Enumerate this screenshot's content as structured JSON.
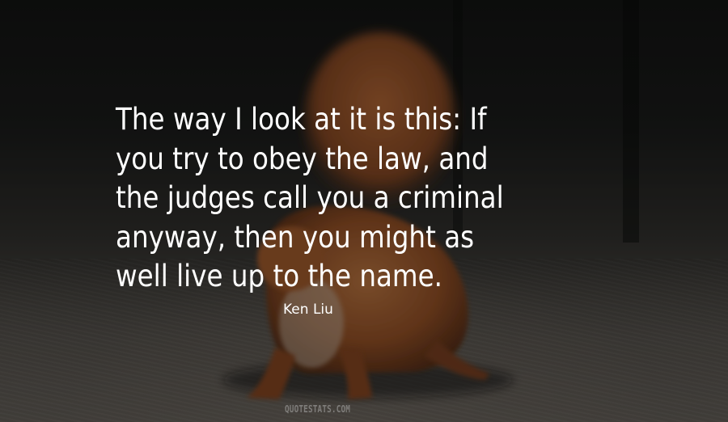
{
  "quote": {
    "lines": [
      "The way I look at it is this: If",
      "you try to obey the law, and",
      "the judges call you a criminal",
      "anyway, then you might as",
      "well live up to the name."
    ]
  },
  "author": "Ken Liu",
  "watermark": "QUOTESTATS.COM",
  "background": {
    "subject": "red squirrel on paved ground",
    "colors": {
      "fur": "#a8562a",
      "ground": "#5e5a55",
      "sky": "#141514"
    }
  }
}
